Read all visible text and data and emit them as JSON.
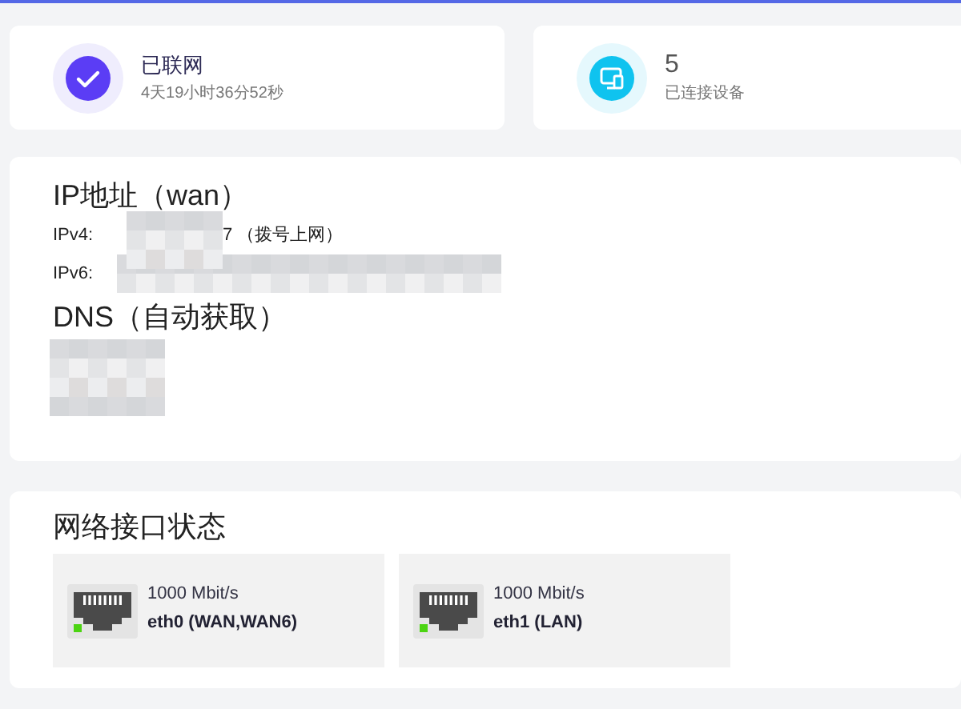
{
  "status_cards": [
    {
      "kind": "internet",
      "title": "已联网",
      "subtitle": "4天19小时36分52秒"
    },
    {
      "kind": "devices",
      "title": "5",
      "subtitle": "已连接设备"
    }
  ],
  "wan": {
    "title": "IP地址（wan）",
    "ipv4_label": "IPv4:",
    "ipv4_visible": "7 （拨号上网）",
    "ipv6_label": "IPv6:",
    "dns_title": "DNS（自动获取）"
  },
  "interfaces": {
    "title": "网络接口状态",
    "ports": [
      {
        "speed": "1000 Mbit/s",
        "name": "eth0 (WAN,WAN6)",
        "link_up": true
      },
      {
        "speed": "1000 Mbit/s",
        "name": "eth1 (LAN)",
        "link_up": true
      }
    ]
  }
}
